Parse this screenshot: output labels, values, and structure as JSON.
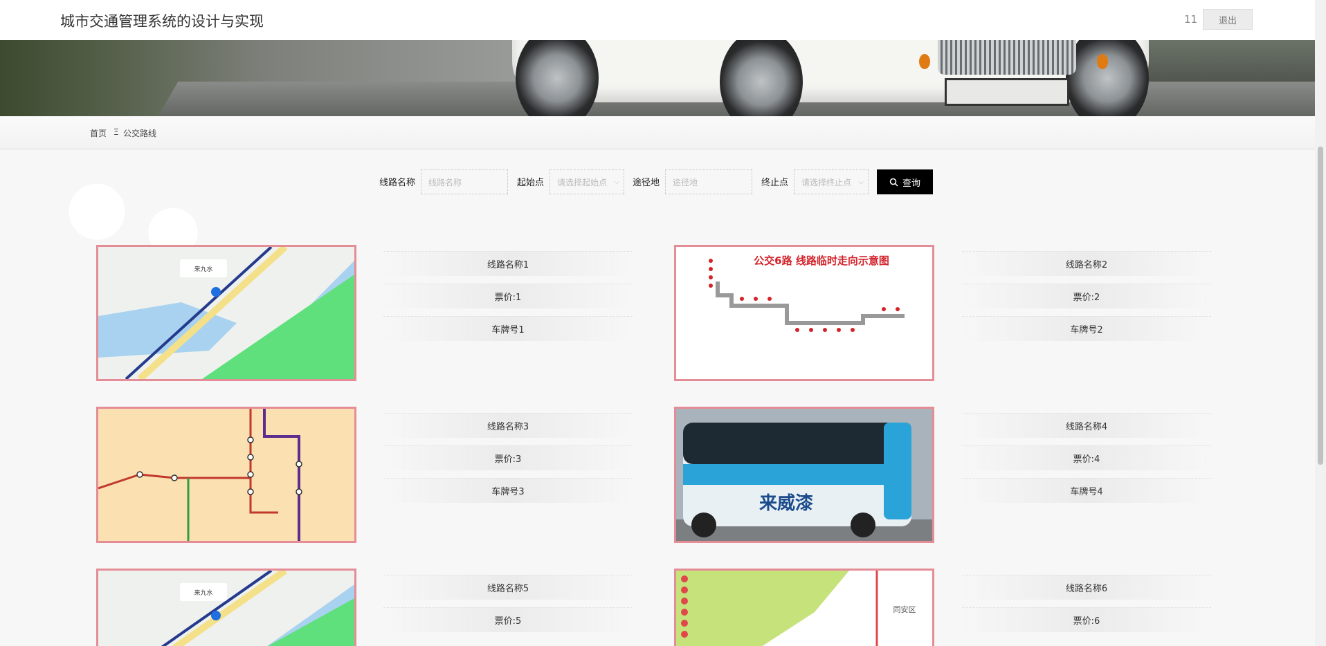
{
  "header": {
    "title": "城市交通管理系统的设计与实现",
    "username": "11",
    "logout_label": "退出"
  },
  "breadcrumb": {
    "home": "首页",
    "separator": "Ξ",
    "current": "公交路线"
  },
  "search": {
    "route_name_label": "线路名称",
    "route_name_placeholder": "线路名称",
    "start_label": "起始点",
    "start_placeholder": "请选择起始点",
    "via_label": "途径地",
    "via_placeholder": "途径地",
    "end_label": "终止点",
    "end_placeholder": "请选择终止点",
    "button_label": "查询"
  },
  "routes": [
    {
      "name": "线路名称1",
      "price": "票价:1",
      "plate": "车牌号1",
      "image": "map-river"
    },
    {
      "name": "线路名称2",
      "price": "票价:2",
      "plate": "车牌号2",
      "image": "route-diagram"
    },
    {
      "name": "线路名称3",
      "price": "票价:3",
      "plate": "车牌号3",
      "image": "metro-map"
    },
    {
      "name": "线路名称4",
      "price": "票价:4",
      "plate": "车牌号4",
      "image": "bus-photo"
    },
    {
      "name": "线路名称5",
      "price": "票价:5",
      "plate": "",
      "image": "map-river"
    },
    {
      "name": "线路名称6",
      "price": "票价:6",
      "plate": "",
      "image": "green-map"
    }
  ],
  "images": {
    "map_label": "来九水",
    "diagram_title": "公交6路 线路临时走向示意图",
    "bus_text": "来威漆",
    "green_map_label": "同安区"
  },
  "colors": {
    "accent_border": "#e58d96",
    "search_button": "#000000"
  }
}
